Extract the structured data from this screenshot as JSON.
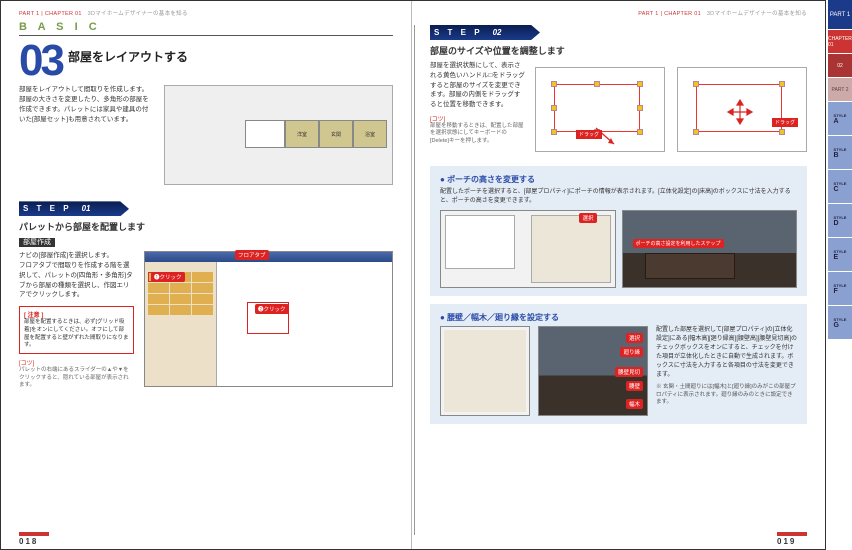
{
  "topbar": {
    "part": "PART 1",
    "chapter": "CHAPTER 01",
    "title": "3Dマイホームデザイナーの基本を知る"
  },
  "basic_label": "B A S I C",
  "section_number": "03",
  "section_title": "部屋をレイアウトする",
  "intro": "部屋をレイアウトして間取りを作成します。部屋の大きさを変更したり、多角形の部屋を作成できます。パレットには家具や建具の付いた[部屋セット]も用意されています。",
  "step1": {
    "label": "S T E P",
    "num": "01",
    "title": "パレットから部屋を配置します",
    "nav_btn": "部屋作成",
    "body": "ナビの[部屋作成]を選択します。\nフロアタブで間取りを作成する階を選択して、パレットの[四角形・多角形]タブから部屋の種類を選択し、作図エリアでクリックします。",
    "callout_floor": "フロアタブ",
    "callout_click1": "❶クリック",
    "callout_click2": "❷クリック",
    "note_lbl": "[ 注意 ]",
    "note": "部屋を配置するときは、必ず[グリッド吸着]をオンにしてください。オフにして部屋を配置すると壁がずれた間取りになります。",
    "tip_lbl": "[コツ]",
    "tip": "パレットの右端にあるスライダーの▲や▼をクリックすると、隠れている部屋が表示されます。"
  },
  "step2": {
    "label": "S T E P",
    "num": "02",
    "title": "部屋のサイズや位置を調整します",
    "body": "部屋を選択状態にして、表示される黄色いハンドル□をドラッグすると部屋のサイズを変更できます。部屋の内側をドラッグすると位置を移動できます。",
    "drag": "ドラッグ",
    "tip_lbl": "[コツ]",
    "tip": "部屋を移動するときは、配置した部屋を選択状態にしてキーボードの[Delete]キーを押します。"
  },
  "info1": {
    "title": "ポーチの高さを変更する",
    "body": "配置したポーチを選択すると、[部屋プロパティ]にポーチの情報が表示されます。[立体化設定]の[床高]のボックスに寸法を入力すると、ポーチの高さを変更できます。",
    "callout_sel": "選択",
    "callout_step": "ポーチの高さ設定を利用したステップ"
  },
  "info2": {
    "title": "腰壁／幅木／廻り縁を設定する",
    "body": "配置した部屋を選択して[部屋プロパティ]の[立体化設定]にある[幅木高][廻り縁高][腰壁高][腰壁見切高]のチェックボックスをオンにすると、チェックを付けた項目が立体化したときに自動で生成されます。ボックスに寸法を入力すると各項目の寸法を変更できます。",
    "note": "※ 玄関・土間廻りには[幅木]と[廻り縁]のみがこの部屋プロパティに表示されます。廻り縁のみのときに設定できます。",
    "c_sel": "選択",
    "c_mawari": "廻り縁",
    "c_koshi": "腰壁見切",
    "c_koshi2": "腰壁",
    "c_haba": "幅木"
  },
  "rooms": {
    "a": "洋室",
    "b": "玄関",
    "c": "浴室"
  },
  "tabs": {
    "part": "PART 1",
    "chap1": "CHAPTER 01",
    "num02": "02",
    "num_s": "PART 2",
    "styles": [
      "A",
      "B",
      "C",
      "D",
      "E",
      "F",
      "G"
    ],
    "style_pre": "STYLE"
  },
  "page_left": "018",
  "page_right": "019"
}
